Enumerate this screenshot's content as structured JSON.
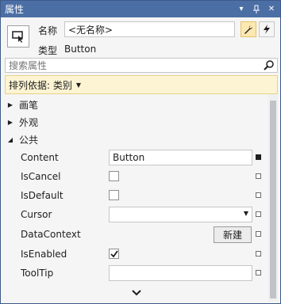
{
  "window": {
    "title": "属性",
    "buttons": [
      "dropdown-icon",
      "pin-icon",
      "close-icon"
    ]
  },
  "header": {
    "name_label": "名称",
    "name_value": "<无名称>",
    "type_label": "类型",
    "type_value": "Button"
  },
  "search": {
    "placeholder": "搜索属性"
  },
  "sort": {
    "label": "排列依据: 类别"
  },
  "categories": [
    {
      "label": "画笔",
      "expanded": false
    },
    {
      "label": "外观",
      "expanded": false
    },
    {
      "label": "公共",
      "expanded": true
    }
  ],
  "properties": [
    {
      "name": "Content",
      "editor": "text",
      "value": "Button"
    },
    {
      "name": "IsCancel",
      "editor": "checkbox",
      "checked": false
    },
    {
      "name": "IsDefault",
      "editor": "checkbox",
      "checked": false
    },
    {
      "name": "Cursor",
      "editor": "combo",
      "value": ""
    },
    {
      "name": "DataContext",
      "editor": "button",
      "button_label": "新建"
    },
    {
      "name": "IsEnabled",
      "editor": "checkbox",
      "checked": true
    },
    {
      "name": "ToolTip",
      "editor": "text",
      "value": ""
    }
  ],
  "colors": {
    "titlebar": "#4b6ea5",
    "accent_active": "#fce8b0",
    "sortbar_bg": "#fdf4d3"
  }
}
